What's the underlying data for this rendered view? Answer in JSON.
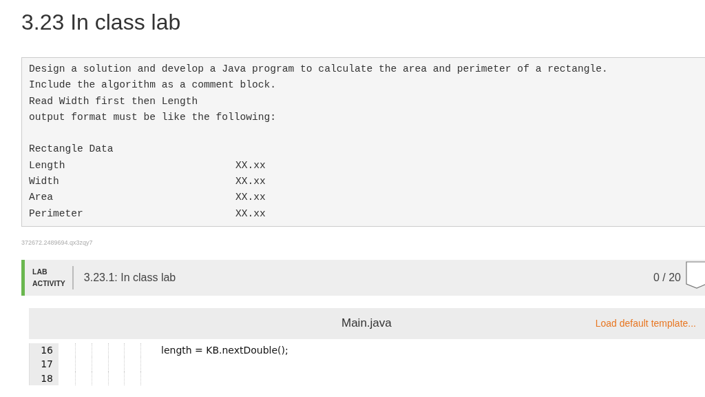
{
  "title": "3.23 In class lab",
  "description": [
    "Design a solution and develop a Java program to calculate the area and perimeter of a rectangle.",
    "Include the algorithm as a comment block.",
    "Read Width first then Length",
    "output format must be like the following:"
  ],
  "output_heading": "Rectangle Data",
  "output_rows": [
    {
      "label": "Length",
      "value": "XX.xx"
    },
    {
      "label": "Width",
      "value": "XX.xx"
    },
    {
      "label": "Area",
      "value": "XX.xx"
    },
    {
      "label": "Perimeter",
      "value": "XX.xx"
    }
  ],
  "resource_id": "372672.2489694.qx3zqy7",
  "activity": {
    "type_line_1": "LAB",
    "type_line_2": "ACTIVITY",
    "title": "3.23.1: In class lab",
    "score": "0 / 20"
  },
  "editor": {
    "filename": "Main.java",
    "load_template": "Load default template...",
    "lines": [
      {
        "number": "16",
        "code": "length = KB.nextDouble();"
      },
      {
        "number": "17"
      },
      {
        "number": "18"
      }
    ]
  }
}
